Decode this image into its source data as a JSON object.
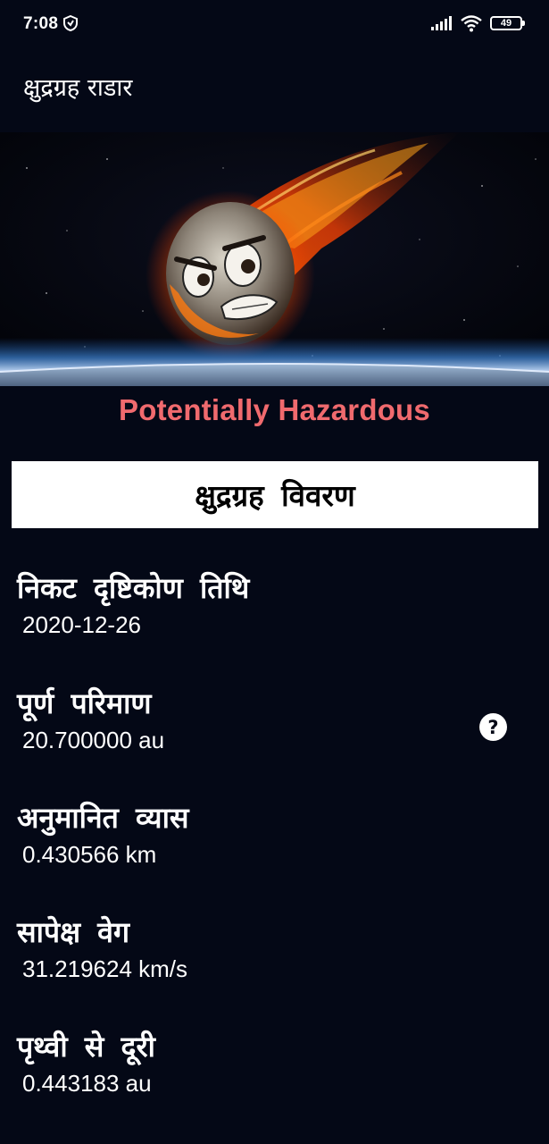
{
  "status_bar": {
    "time": "7:08",
    "battery": "49",
    "icons": [
      "shield-icon",
      "signal-icon",
      "wifi-icon",
      "battery-icon"
    ]
  },
  "app_bar": {
    "title": "क्षुद्रग्रह राडार"
  },
  "hero": {
    "image": "flaming-asteroid-over-earth",
    "hazard_label": "Potentially Hazardous"
  },
  "details": {
    "header": "क्षुद्रग्रह विवरण",
    "items": [
      {
        "label": "निकट दृष्टिकोण तिथि",
        "value": "2020-12-26"
      },
      {
        "label": "पूर्ण परिमाण",
        "value": "20.700000 au"
      },
      {
        "label": "अनुमानित व्यास",
        "value": "0.430566 km"
      },
      {
        "label": "सापेक्ष वेग",
        "value": "31.219624 km/s"
      },
      {
        "label": "पृथ्वी से दूरी",
        "value": "0.443183 au"
      }
    ],
    "help_symbol": "?"
  },
  "colors": {
    "background": "#040816",
    "hazard_text": "#f06a6e",
    "header_background": "#ffffff"
  }
}
